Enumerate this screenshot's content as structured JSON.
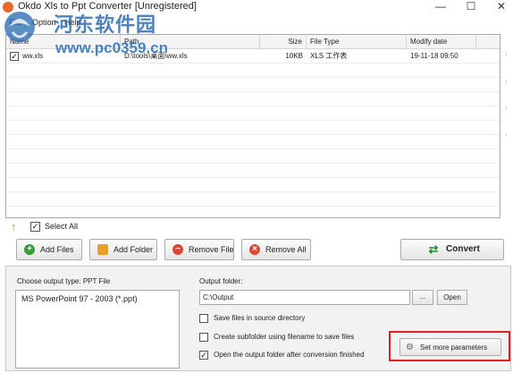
{
  "window": {
    "title": "Okdo Xls to Ppt Converter [Unregistered]",
    "minimize": "—",
    "maximize": "☐",
    "close": "✕"
  },
  "menu": {
    "file": "File",
    "option": "Option",
    "help": "Help"
  },
  "watermark": {
    "title": "河东软件园",
    "url": "www.pc0359.cn"
  },
  "file_list": {
    "columns": [
      "Name",
      "Path",
      "Size",
      "File Type",
      "Modify date"
    ],
    "rows": [
      {
        "checked": "✓",
        "name": "ww.xls",
        "path": "D:\\tools\\桌面\\ww.xls",
        "size": "10KB",
        "type": "XLS 工作表",
        "date": "19-11-18 09:50"
      }
    ]
  },
  "select_all": {
    "label": "Select All",
    "checked": "✓"
  },
  "toolbar": {
    "add_files": "Add Files",
    "add_folder": "Add Folder",
    "remove_file": "Remove File",
    "remove_all": "Remove All",
    "convert": "Convert"
  },
  "output": {
    "type_label": "Choose output type:  PPT File",
    "type_options": [
      "MS PowerPoint 97 - 2003 (*.ppt)"
    ],
    "folder_label": "Output folder:",
    "folder_value": "C:\\Output",
    "browse": "...",
    "open": "Open",
    "option_save_source": "Save files in source directory",
    "option_subfolder": "Create subfolder using filename to save files",
    "option_open_after": "Open the output folder after conversion finished",
    "option_open_after_checked": "✓",
    "more_params": "Set more parameters"
  },
  "colors": {
    "highlight": "#e02020",
    "accent_orange": "#e88a1e"
  }
}
